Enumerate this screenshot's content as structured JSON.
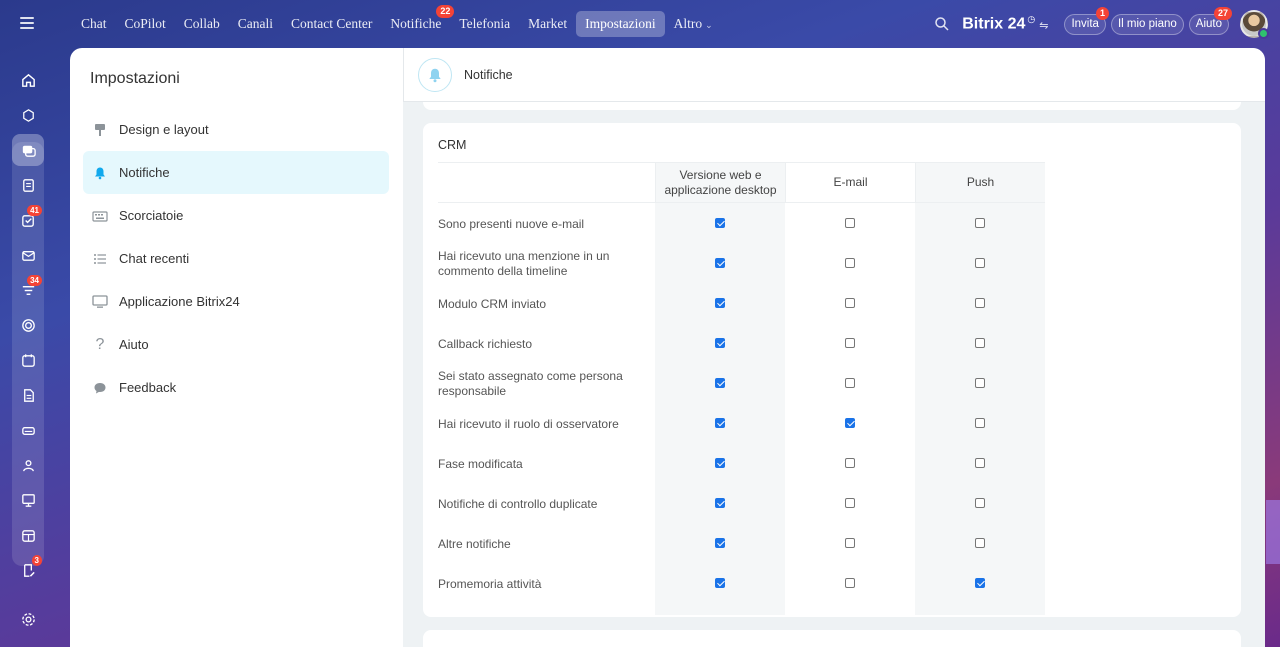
{
  "topnav": {
    "items": [
      {
        "label": "Chat"
      },
      {
        "label": "CoPilot"
      },
      {
        "label": "Collab"
      },
      {
        "label": "Canali"
      },
      {
        "label": "Contact Center"
      },
      {
        "label": "Notifiche",
        "badge": "22"
      },
      {
        "label": "Telefonia"
      },
      {
        "label": "Market"
      },
      {
        "label": "Impostazioni",
        "active": true
      },
      {
        "label": "Altro"
      }
    ],
    "brand": "Bitrix",
    "brand_num": "24",
    "invite_label": "Invita",
    "invite_badge": "1",
    "plan_label": "Il mio piano",
    "help_label": "Aiuto",
    "help_badge": "27"
  },
  "rail": {
    "badges": {
      "tasks": "41",
      "funnel": "34",
      "forms": "3"
    }
  },
  "settings": {
    "title": "Impostazioni",
    "menu": [
      {
        "label": "Design e layout",
        "icon": "brush-icon"
      },
      {
        "label": "Notifiche",
        "icon": "bell-icon",
        "active": true
      },
      {
        "label": "Scorciatoie",
        "icon": "keyboard-icon"
      },
      {
        "label": "Chat recenti",
        "icon": "list-icon"
      },
      {
        "label": "Applicazione Bitrix24",
        "icon": "monitor-icon"
      },
      {
        "label": "Aiuto",
        "icon": "question-icon"
      },
      {
        "label": "Feedback",
        "icon": "speech-bubble-icon"
      }
    ]
  },
  "content": {
    "header_title": "Notifiche",
    "section_title": "CRM",
    "columns": [
      "Versione web e applicazione desktop",
      "E-mail",
      "Push"
    ],
    "rows": [
      {
        "label": "Sono presenti nuove e-mail",
        "web": true,
        "email": false,
        "push": false
      },
      {
        "label": "Hai ricevuto una menzione in un commento della timeline",
        "web": true,
        "email": false,
        "push": false
      },
      {
        "label": "Modulo CRM inviato",
        "web": true,
        "email": false,
        "push": false
      },
      {
        "label": "Callback richiesto",
        "web": true,
        "email": false,
        "push": false
      },
      {
        "label": "Sei stato assegnato come persona responsabile",
        "web": true,
        "email": false,
        "push": false
      },
      {
        "label": "Hai ricevuto il ruolo di osservatore",
        "web": true,
        "email": true,
        "push": false
      },
      {
        "label": "Fase modificata",
        "web": true,
        "email": false,
        "push": false
      },
      {
        "label": "Notifiche di controllo duplicate",
        "web": true,
        "email": false,
        "push": false
      },
      {
        "label": "Altre notifiche",
        "web": true,
        "email": false,
        "push": false
      },
      {
        "label": "Promemoria attività",
        "web": true,
        "email": false,
        "push": true
      }
    ]
  },
  "colors": {
    "accent": "#2fc6f6",
    "checkbox": "#1a73e8",
    "badge": "#f44336",
    "active_menu": "#e5f8fd"
  }
}
